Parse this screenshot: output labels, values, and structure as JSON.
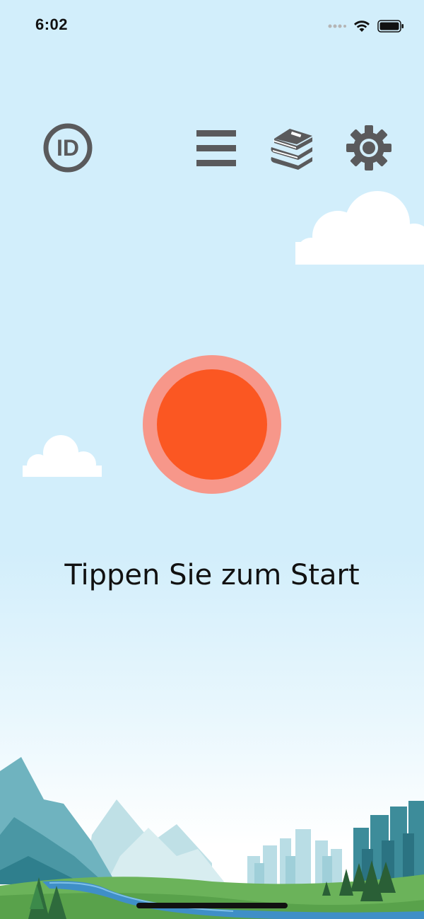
{
  "status_bar": {
    "time": "6:02",
    "icons": [
      "cellular-signal-icon",
      "wifi-icon",
      "battery-icon"
    ]
  },
  "toolbar": {
    "id_icon_text": "ID",
    "items": [
      "id-icon",
      "menu-icon",
      "library-books-icon",
      "settings-gear-icon"
    ]
  },
  "main": {
    "record_button": "record-button",
    "prompt": "Tippen Sie zum Start"
  },
  "colors": {
    "sky": "#d2eefb",
    "icon_gray": "#5a5a5c",
    "record_outer": "#f7978a",
    "record_inner": "#fb5722"
  }
}
